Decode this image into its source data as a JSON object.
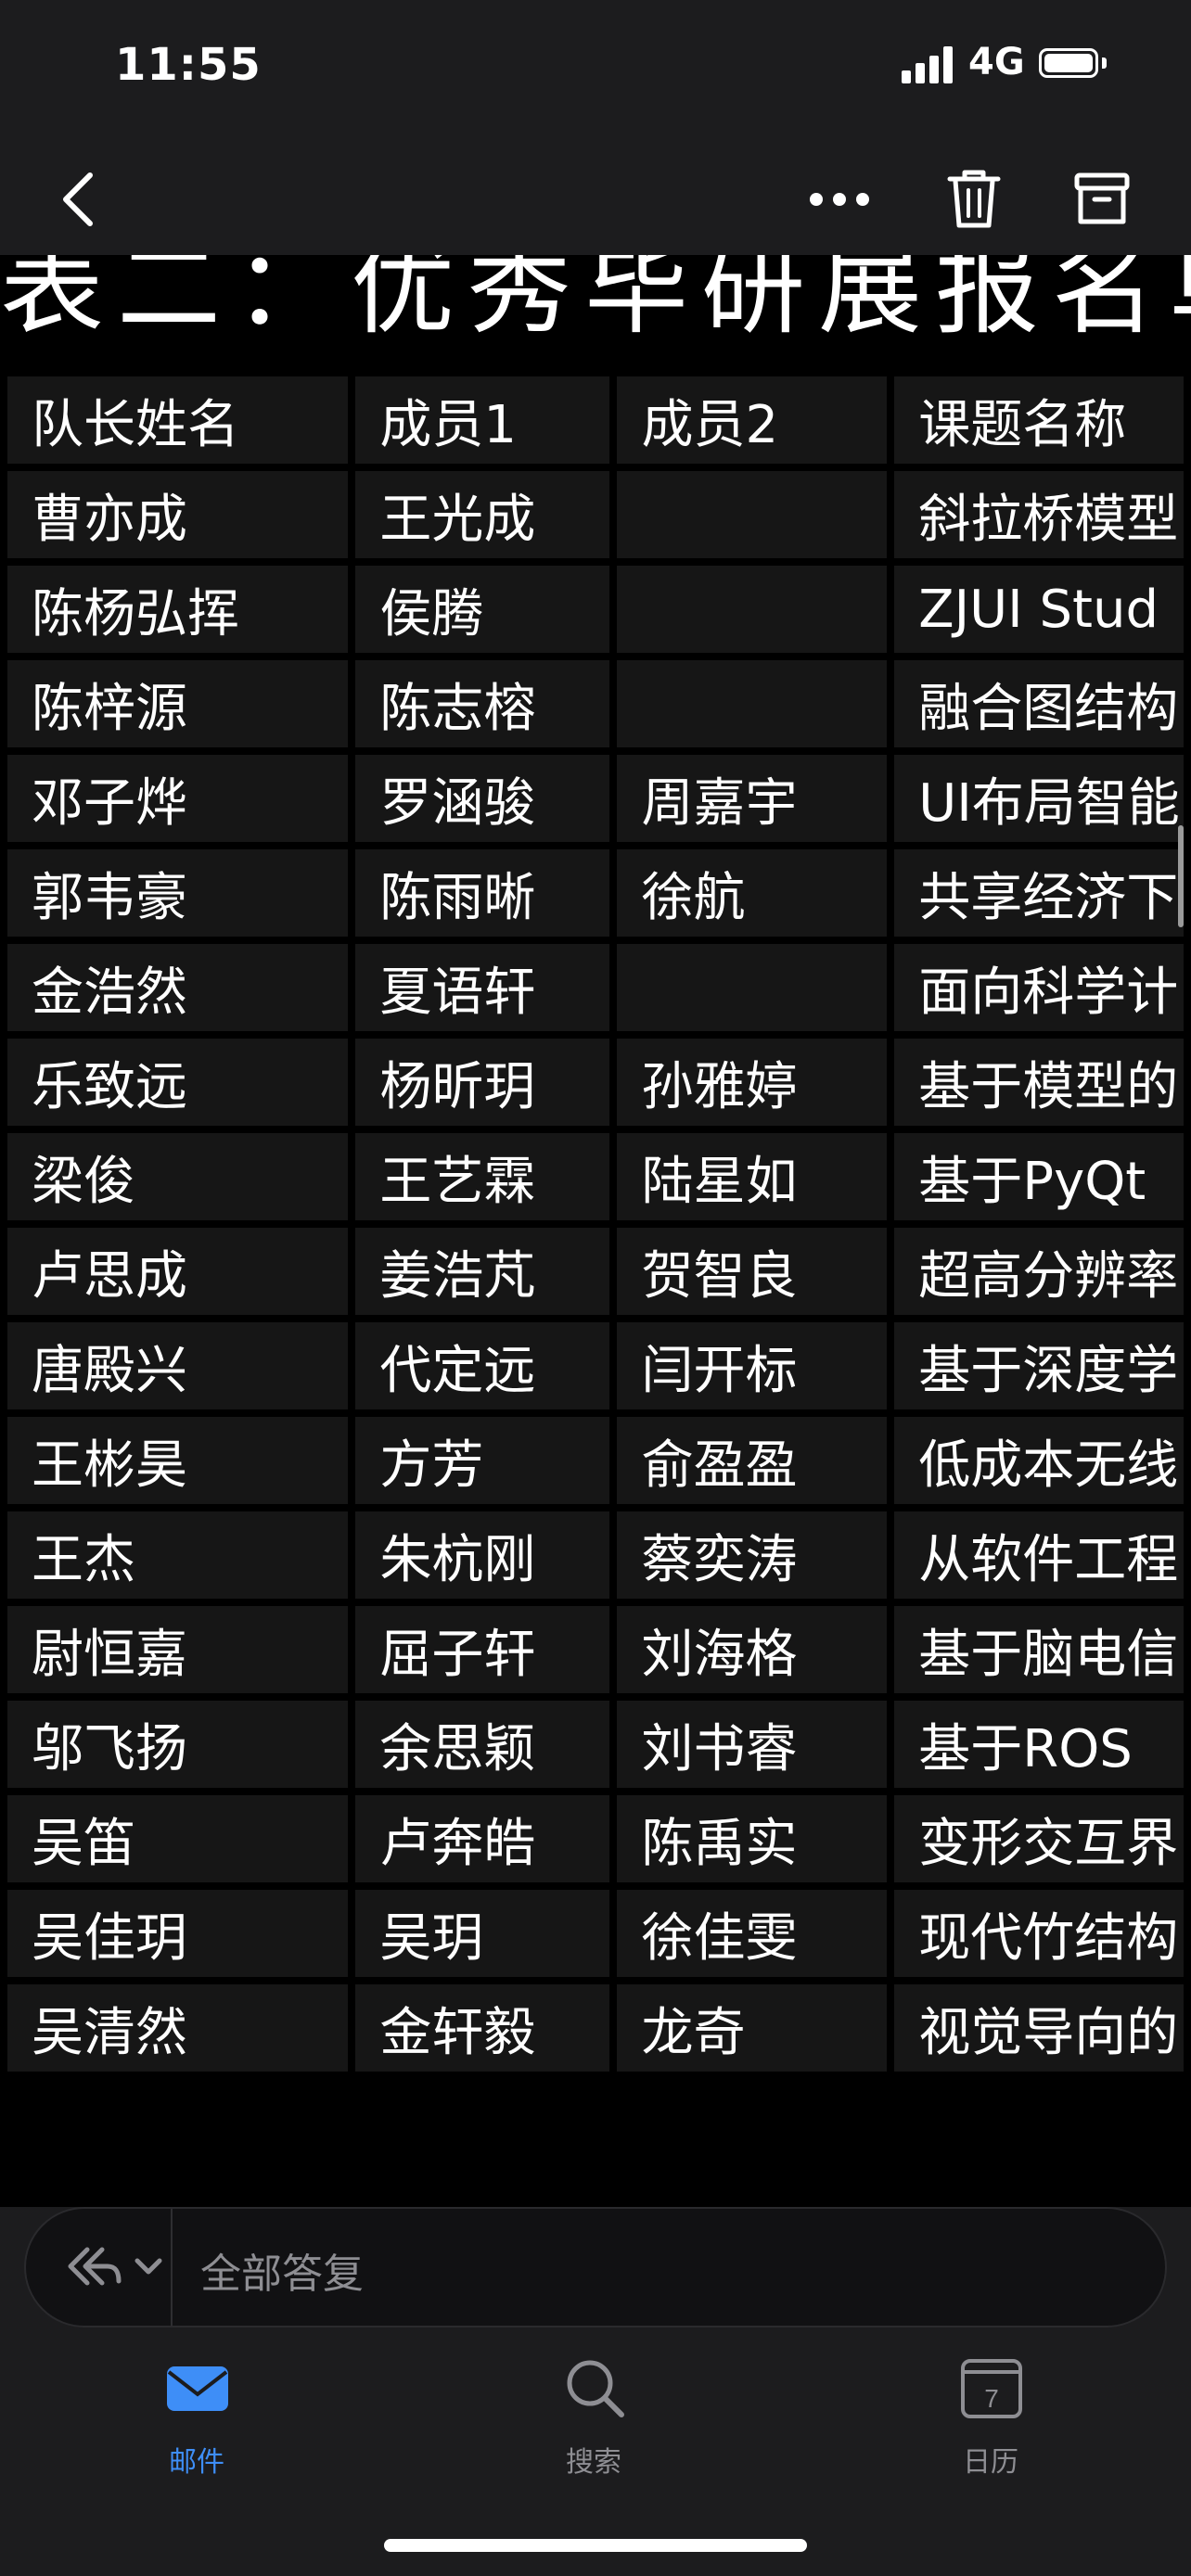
{
  "status": {
    "time": "11:55",
    "network": "4G"
  },
  "message": {
    "title_partial": "表二：优秀毕研展报名单",
    "table": {
      "headers": [
        "队长姓名",
        "成员1",
        "成员2",
        "课题名称"
      ],
      "rows": [
        [
          "曹亦成",
          "王光成",
          "",
          "斜拉桥模型"
        ],
        [
          "陈杨弘挥",
          "侯腾",
          "",
          "ZJUI Stud"
        ],
        [
          "陈梓源",
          "陈志榕",
          "",
          "融合图结构"
        ],
        [
          "邓子烨",
          "罗涵骏",
          "周嘉宇",
          "UI布局智能"
        ],
        [
          "郭韦豪",
          "陈雨晰",
          "徐航",
          "共享经济下"
        ],
        [
          "金浩然",
          "夏语轩",
          "",
          "面向科学计"
        ],
        [
          "乐致远",
          "杨昕玥",
          "孙雅婷",
          "基于模型的"
        ],
        [
          "梁俊",
          "王艺霖",
          "陆星如",
          "基于PyQt"
        ],
        [
          "卢思成",
          "姜浩芃",
          "贺智良",
          "超高分辨率"
        ],
        [
          "唐殿兴",
          "代定远",
          "闫开标",
          "基于深度学"
        ],
        [
          "王彬昊",
          "方芳",
          "俞盈盈",
          "低成本无线"
        ],
        [
          "王杰",
          "朱杭刚",
          "蔡奕涛",
          "从软件工程"
        ],
        [
          "尉恒嘉",
          "屈子轩",
          "刘海格",
          "基于脑电信"
        ],
        [
          "邬飞扬",
          "余思颖",
          "刘书睿",
          "基于ROS"
        ],
        [
          "吴笛",
          "卢奔皓",
          "陈禹实",
          "变形交互界"
        ],
        [
          "吴佳玥",
          "吴玥",
          "徐佳雯",
          "现代竹结构"
        ],
        [
          "吴清然",
          "金轩毅",
          "龙奇",
          "视觉导向的"
        ]
      ]
    }
  },
  "reply": {
    "placeholder": "全部答复"
  },
  "tabs": [
    {
      "label": "邮件",
      "icon": "mail-icon",
      "active": true
    },
    {
      "label": "搜索",
      "icon": "search-icon",
      "active": false
    },
    {
      "label": "日历",
      "icon": "calendar-icon",
      "active": false,
      "day": "7"
    }
  ],
  "colors": {
    "accent": "#3e8ef7",
    "background": "#1c1c1e",
    "content_bg": "#000000"
  }
}
